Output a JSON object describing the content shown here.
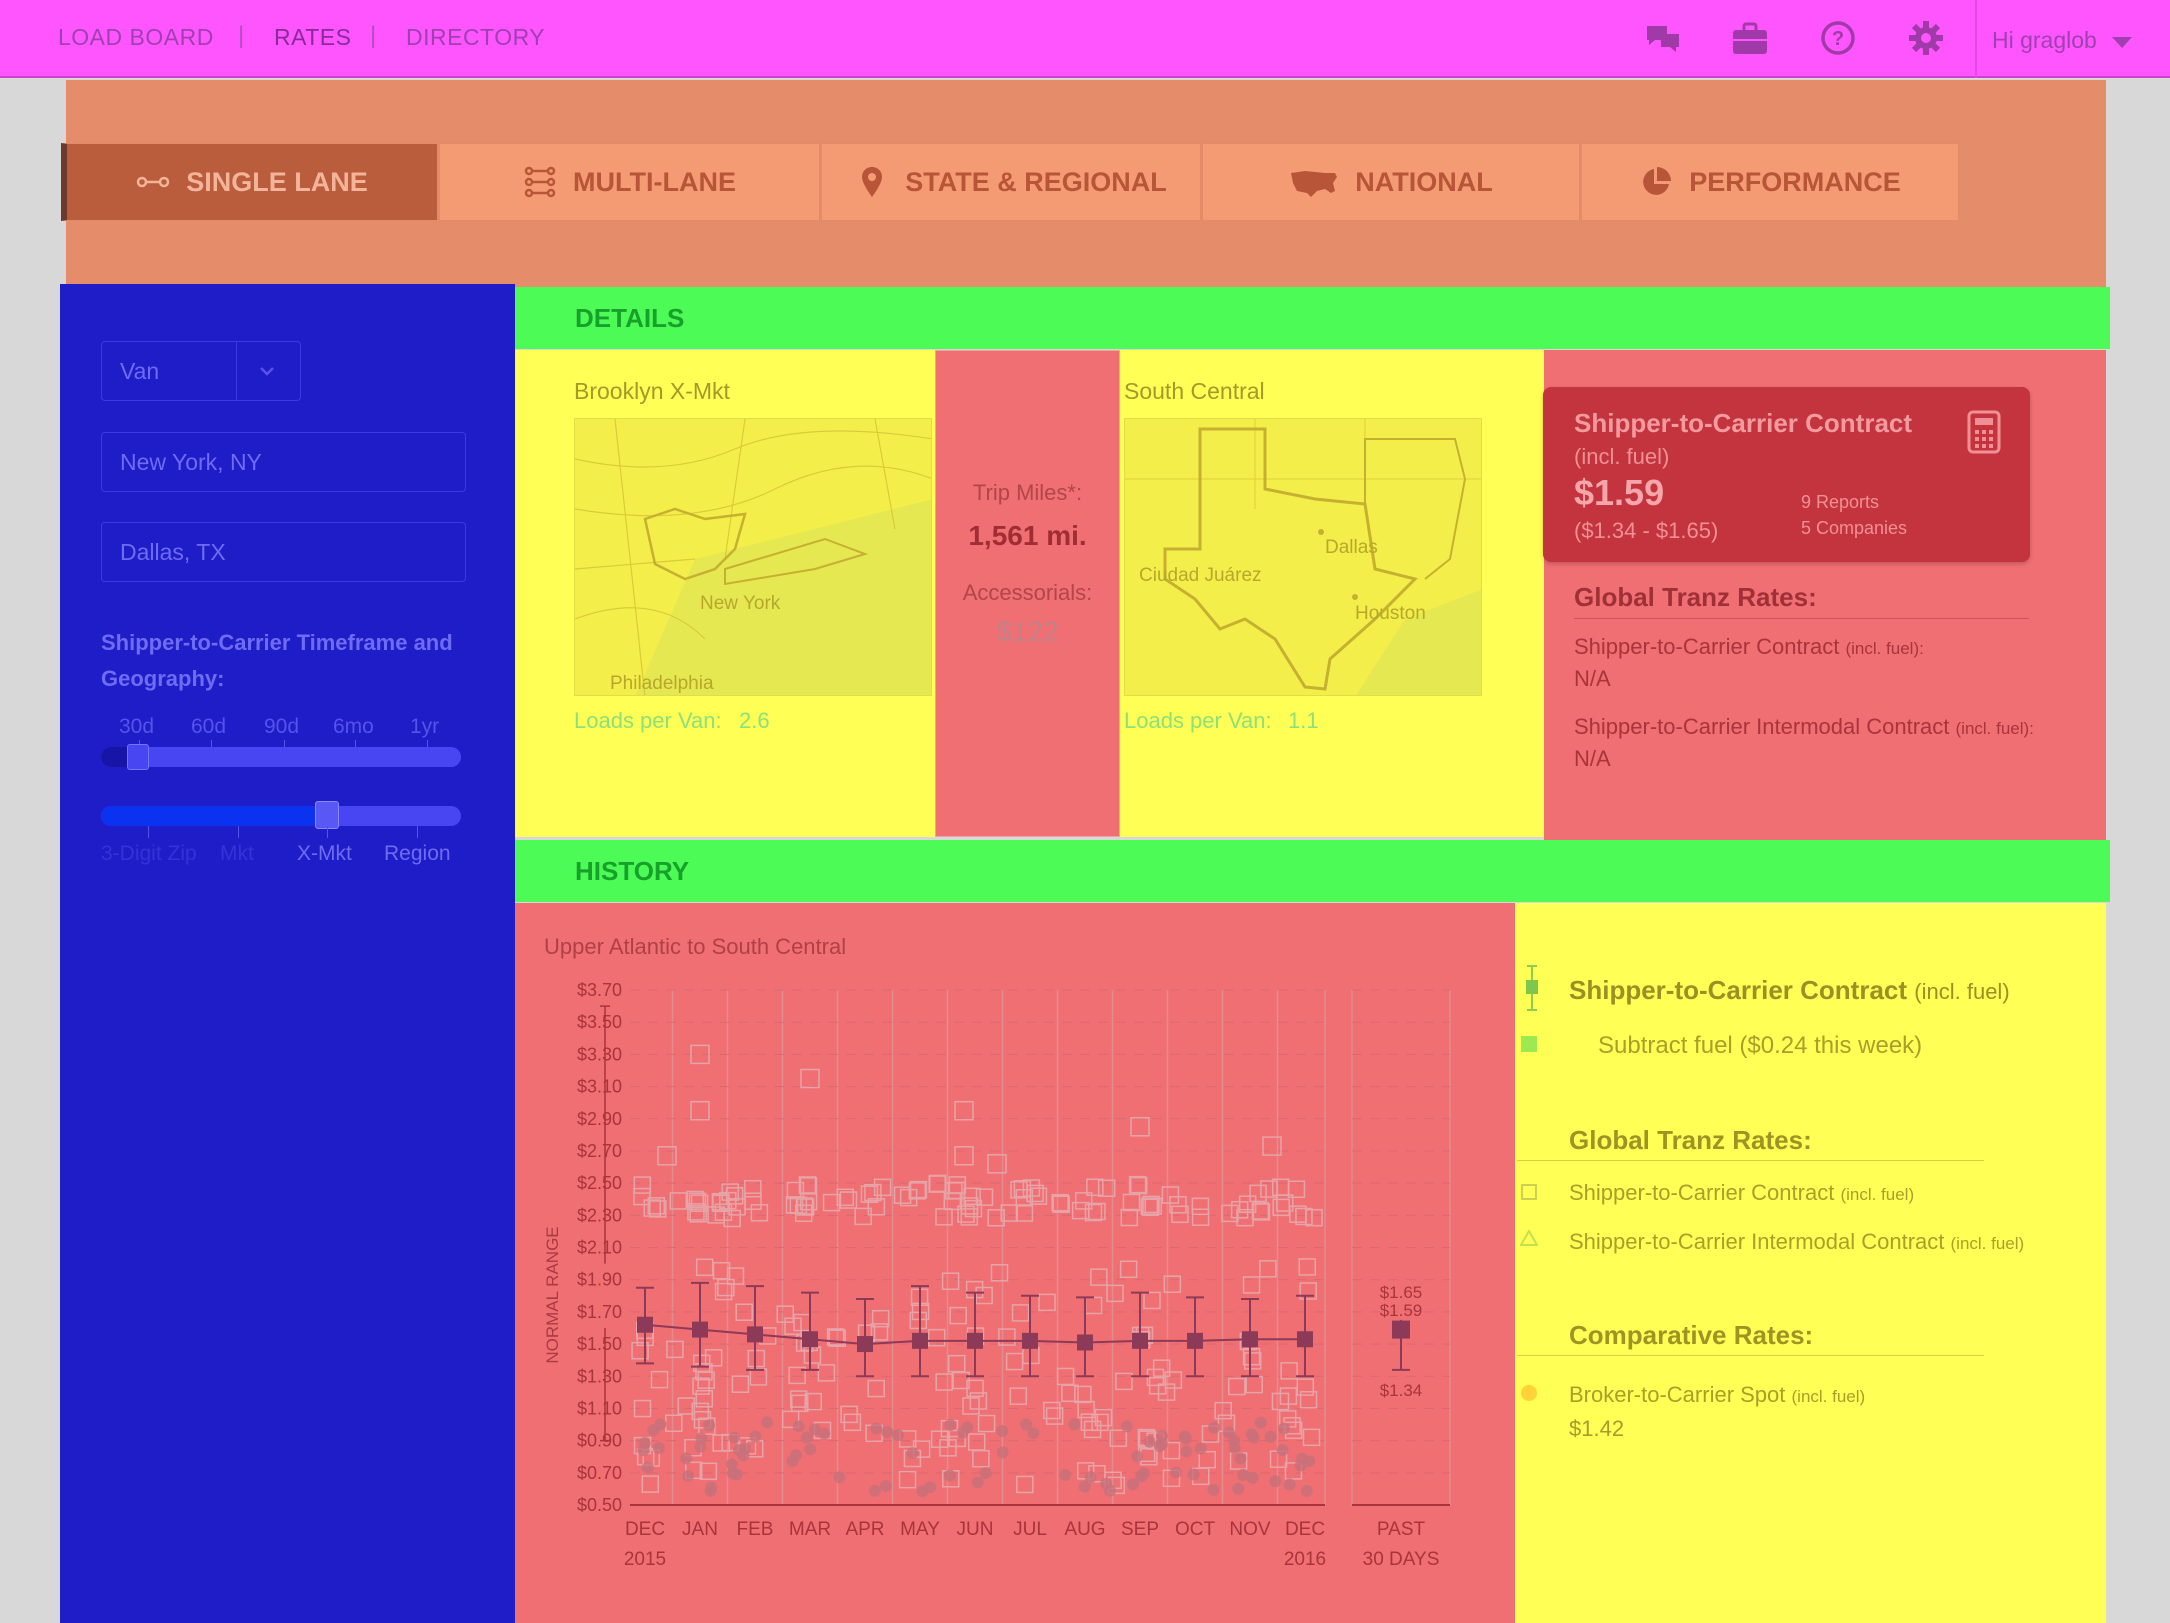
{
  "nav": {
    "links": [
      "LOAD BOARD",
      "RATES",
      "DIRECTORY"
    ],
    "separator": "|",
    "user": "Hi graglob",
    "icons": [
      "chat-icon",
      "briefcase-icon",
      "help-icon",
      "gear-icon"
    ]
  },
  "tabs": [
    {
      "label": "SINGLE LANE",
      "icon": "lane-icon",
      "active": true
    },
    {
      "label": "MULTI-LANE",
      "icon": "multilane-icon",
      "active": false
    },
    {
      "label": "STATE & REGIONAL",
      "icon": "pin-icon",
      "active": false
    },
    {
      "label": "NATIONAL",
      "icon": "usa-map-icon",
      "active": false
    },
    {
      "label": "PERFORMANCE",
      "icon": "pie-icon",
      "active": false
    }
  ],
  "sidebar": {
    "equipment": "Van",
    "origin": "New York, NY",
    "destination": "Dallas, TX",
    "timeframe_title": "Shipper-to-Carrier Timeframe and Geography:",
    "timeframe_ticks": [
      "30d",
      "60d",
      "90d",
      "6mo",
      "1yr"
    ],
    "timeframe_selected": "30d",
    "geo_ticks": [
      "3-Digit Zip",
      "Mkt",
      "X-Mkt",
      "Region"
    ],
    "geo_selected": "X-Mkt"
  },
  "details": {
    "header": "DETAILS",
    "origin": {
      "title": "Brooklyn X-Mkt",
      "loads_label": "Loads per Van:",
      "loads_value": "2.6",
      "map_labels": [
        "New York",
        "Philadelphia"
      ]
    },
    "destination": {
      "title": "South Central",
      "loads_label": "Loads per Van:",
      "loads_value": "1.1",
      "map_labels": [
        "Dallas",
        "Ciudad Juárez",
        "Houston"
      ]
    },
    "trip_label": "Trip Miles*:",
    "trip_value": "1,561 mi.",
    "acc_label": "Accessorials:",
    "acc_value": "$122",
    "contract": {
      "title": "Shipper-to-Carrier Contract",
      "subtitle": "(incl. fuel)",
      "rate": "$1.59",
      "range": "($1.34 - $1.65)",
      "reports": "9 Reports",
      "companies": "5 Companies"
    },
    "global": {
      "title": "Global Tranz Rates:",
      "contract_label": "Shipper-to-Carrier Contract",
      "contract_note": "(incl. fuel):",
      "contract_value": "N/A",
      "intermodal_label": "Shipper-to-Carrier Intermodal Contract",
      "intermodal_note": "(incl. fuel):",
      "intermodal_value": "N/A"
    }
  },
  "history": {
    "header": "HISTORY",
    "lane_from": "Upper Atlantic",
    "lane_to": "to",
    "lane_dest": "South Central"
  },
  "legend": {
    "contract": "Shipper-to-Carrier Contract",
    "contract_note": "(incl. fuel)",
    "subtract": "Subtract fuel ($0.24 this week)",
    "global_title": "Global Tranz Rates:",
    "g_contract": "Shipper-to-Carrier Contract",
    "g_contract_note": "(incl. fuel)",
    "g_intermodal": "Shipper-to-Carrier Intermodal Contract",
    "g_intermodal_note": "(incl. fuel)",
    "comp_title": "Comparative Rates:",
    "broker": "Broker-to-Carrier Spot",
    "broker_note": "(incl. fuel)",
    "broker_value": "$1.42"
  },
  "chart_data": {
    "type": "scatter",
    "ylabel": "NORMAL RANGE",
    "y_ticks": [
      "$3.70",
      "$3.50",
      "$3.30",
      "$3.10",
      "$2.90",
      "$2.70",
      "$2.50",
      "$2.30",
      "$2.10",
      "$1.90",
      "$1.70",
      "$1.50",
      "$1.30",
      "$1.10",
      "$0.90",
      "$0.70",
      "$0.50"
    ],
    "ylim": [
      0.5,
      3.7
    ],
    "categories": [
      "DEC",
      "JAN",
      "FEB",
      "MAR",
      "APR",
      "MAY",
      "JUN",
      "JUL",
      "AUG",
      "SEP",
      "OCT",
      "NOV",
      "DEC"
    ],
    "category_years": [
      "2015",
      "",
      "",
      "",
      "",
      "",
      "",
      "",
      "",
      "",
      "",
      "",
      "2016"
    ],
    "series": [
      {
        "name": "Shipper-to-Carrier Contract",
        "values": [
          1.62,
          1.59,
          1.56,
          1.53,
          1.5,
          1.52,
          1.52,
          1.52,
          1.51,
          1.52,
          1.52,
          1.53,
          1.53
        ],
        "low": [
          1.38,
          1.36,
          1.34,
          1.34,
          1.3,
          1.3,
          1.3,
          1.3,
          1.3,
          1.3,
          1.3,
          1.3,
          1.3
        ],
        "high": [
          1.85,
          1.88,
          1.86,
          1.82,
          1.78,
          1.86,
          1.82,
          1.8,
          1.79,
          1.82,
          1.79,
          1.78,
          1.8
        ]
      }
    ],
    "outliers": [
      {
        "x": 1,
        "y": 3.3
      },
      {
        "x": 1,
        "y": 2.95
      },
      {
        "x": 0.4,
        "y": 2.67
      },
      {
        "x": 3,
        "y": 3.15
      },
      {
        "x": 5.8,
        "y": 2.95
      },
      {
        "x": 5.8,
        "y": 2.67
      },
      {
        "x": 6.4,
        "y": 2.62
      },
      {
        "x": 9.0,
        "y": 2.85
      },
      {
        "x": 11.4,
        "y": 2.73
      }
    ],
    "past30": {
      "label": "PAST",
      "label2": "30 DAYS",
      "value": 1.59,
      "high": 1.65,
      "low": 1.34,
      "high_label": "$1.65",
      "value_label": "$1.59",
      "low_label": "$1.34"
    }
  },
  "colors": {
    "accent": "#ff55ff",
    "sidebar": "#1f1dc8",
    "green": "#4dfb57",
    "yellow": "#ffff55",
    "red": "#f06f73",
    "card": "#c3343e"
  }
}
